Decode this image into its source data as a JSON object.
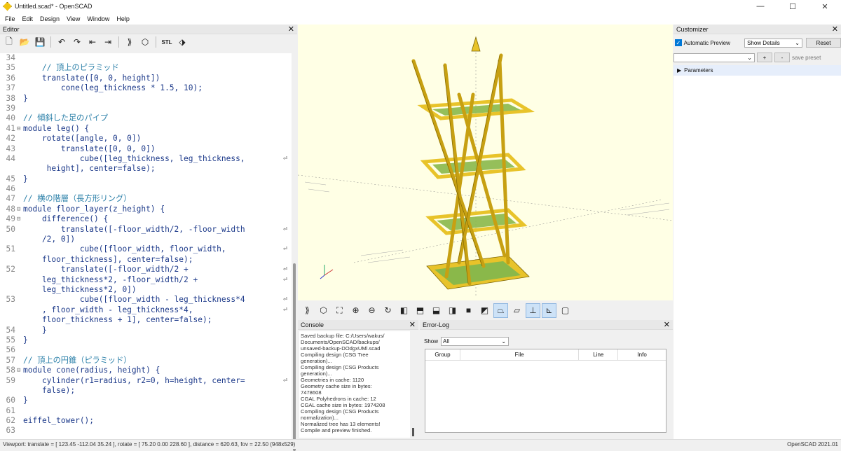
{
  "window": {
    "title": "Untitled.scad* - OpenSCAD",
    "controls": [
      "—",
      "☐",
      "✕"
    ]
  },
  "menu": [
    "File",
    "Edit",
    "Design",
    "View",
    "Window",
    "Help"
  ],
  "editor": {
    "title": "Editor",
    "lines": [
      {
        "n": "34",
        "text": "",
        "fold": ""
      },
      {
        "n": "35",
        "text": "    // 頂上のピラミッド",
        "fold": "",
        "cls": "comment"
      },
      {
        "n": "36",
        "text": "    translate([0, 0, height])",
        "fold": ""
      },
      {
        "n": "37",
        "text": "        cone(leg_thickness * 1.5, 10);",
        "fold": ""
      },
      {
        "n": "38",
        "text": "}",
        "fold": ""
      },
      {
        "n": "39",
        "text": "",
        "fold": ""
      },
      {
        "n": "40",
        "text": "// 傾斜した足のパイプ",
        "fold": "",
        "cls": "comment"
      },
      {
        "n": "41",
        "text": "module leg() {",
        "fold": "⊟"
      },
      {
        "n": "42",
        "text": "    rotate([angle, 0, 0])",
        "fold": ""
      },
      {
        "n": "43",
        "text": "        translate([0, 0, 0])",
        "fold": ""
      },
      {
        "n": "44",
        "text": "            cube([leg_thickness, leg_thickness,",
        "fold": "",
        "wrap": "⏎"
      },
      {
        "n": "",
        "text": "     height], center=false);",
        "fold": ""
      },
      {
        "n": "45",
        "text": "}",
        "fold": ""
      },
      {
        "n": "46",
        "text": "",
        "fold": ""
      },
      {
        "n": "47",
        "text": "// 横の階層（長方形リング）",
        "fold": "",
        "cls": "comment"
      },
      {
        "n": "48",
        "text": "module floor_layer(z_height) {",
        "fold": "⊟"
      },
      {
        "n": "49",
        "text": "    difference() {",
        "fold": "⊟"
      },
      {
        "n": "50",
        "text": "        translate([-floor_width/2, -floor_width",
        "fold": "",
        "wrap": "⏎"
      },
      {
        "n": "",
        "text": "    /2, 0])",
        "fold": ""
      },
      {
        "n": "51",
        "text": "            cube([floor_width, floor_width,",
        "fold": "",
        "wrap": "⏎"
      },
      {
        "n": "",
        "text": "    floor_thickness], center=false);",
        "fold": ""
      },
      {
        "n": "52",
        "text": "        translate([-floor_width/2 +",
        "fold": "",
        "wrap": "⏎"
      },
      {
        "n": "",
        "text": "    leg_thickness*2, -floor_width/2 +",
        "fold": "",
        "wrap": "⏎"
      },
      {
        "n": "",
        "text": "    leg_thickness*2, 0])",
        "fold": ""
      },
      {
        "n": "53",
        "text": "            cube([floor_width - leg_thickness*4",
        "fold": "",
        "wrap": "⏎"
      },
      {
        "n": "",
        "text": "    , floor_width - leg_thickness*4,",
        "fold": "",
        "wrap": "⏎"
      },
      {
        "n": "",
        "text": "    floor_thickness + 1], center=false);",
        "fold": ""
      },
      {
        "n": "54",
        "text": "    }",
        "fold": ""
      },
      {
        "n": "55",
        "text": "}",
        "fold": ""
      },
      {
        "n": "56",
        "text": "",
        "fold": ""
      },
      {
        "n": "57",
        "text": "// 頂上の円錐（ピラミッド）",
        "fold": "",
        "cls": "comment"
      },
      {
        "n": "58",
        "text": "module cone(radius, height) {",
        "fold": "⊟"
      },
      {
        "n": "59",
        "text": "    cylinder(r1=radius, r2=0, h=height, center=",
        "fold": "",
        "wrap": "⏎"
      },
      {
        "n": "",
        "text": "    false);",
        "fold": ""
      },
      {
        "n": "60",
        "text": "}",
        "fold": ""
      },
      {
        "n": "61",
        "text": "",
        "fold": ""
      },
      {
        "n": "62",
        "text": "eiffel_tower();",
        "fold": ""
      },
      {
        "n": "63",
        "text": "",
        "fold": ""
      }
    ]
  },
  "viewport": {
    "background": "#ffffe5",
    "model_color": "#e8c32a",
    "fill_color": "#8ab84a"
  },
  "console": {
    "title": "Console",
    "lines": [
      "Saved backup file: C:/Users/wakus/",
      "Documents/OpenSCAD/backups/",
      "unsaved-backup-DOdgxUMl.scad",
      "Compiling design (CSG Tree",
      "generation)...",
      "Compiling design (CSG Products",
      "generation)...",
      "Geometries in cache: 1120",
      "Geometry cache size in bytes:",
      "7478608",
      "CGAL Polyhedrons in cache: 12",
      "CGAL cache size in bytes: 1974208",
      "Compiling design (CSG Products",
      "normalization)...",
      "Normalized tree has 13 elements!",
      "Compile and preview finished."
    ]
  },
  "errorlog": {
    "title": "Error-Log",
    "show_label": "Show",
    "show_value": "All",
    "columns": [
      "Group",
      "File",
      "Line",
      "Info"
    ]
  },
  "customizer": {
    "title": "Customizer",
    "auto_preview_label": "Automatic Preview",
    "show_details": "Show Details",
    "reset_label": "Reset",
    "preset_value": "",
    "plus": "+",
    "minus": "-",
    "save_preset": "save preset",
    "params_label": "Parameters"
  },
  "statusbar": {
    "left": "Viewport: translate = [ 123.45 -112.04 35.24 ], rotate = [ 75.20 0.00 228.60 ], distance = 620.63, fov = 22.50 (948x529)",
    "right": "OpenSCAD 2021.01"
  }
}
